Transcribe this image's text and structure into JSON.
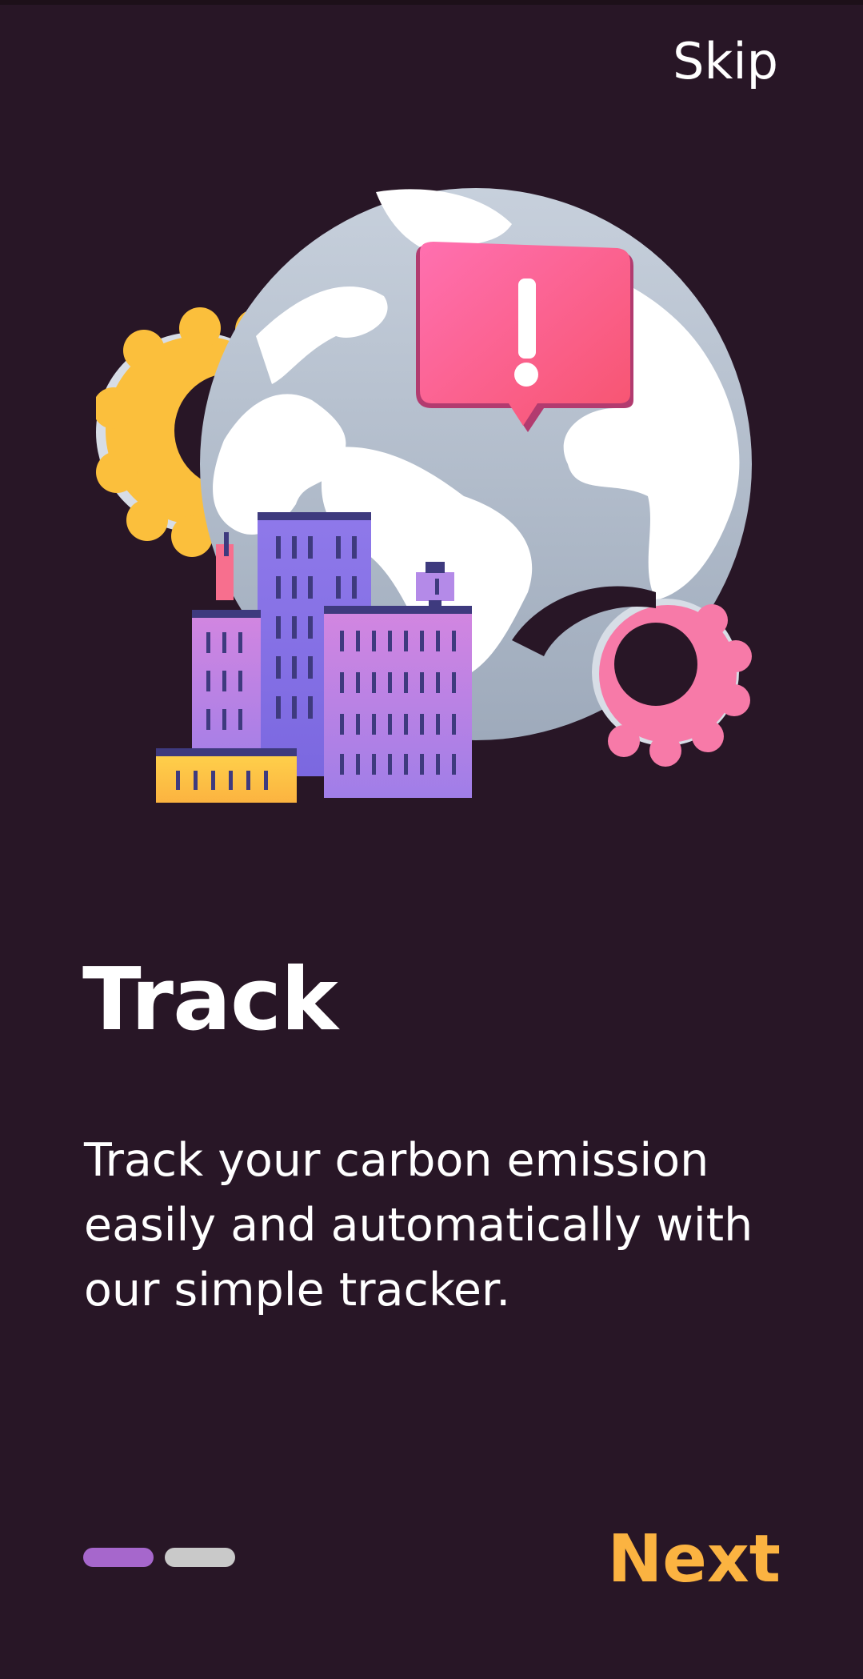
{
  "header": {
    "skip_label": "Skip"
  },
  "illustration": {
    "icons": [
      "globe-icon",
      "alert-speech-bubble-icon",
      "gear-icon",
      "city-buildings-icon"
    ],
    "colors": {
      "gear_yellow": "#fbbf3c",
      "gear_pink": "#f77aa8",
      "bubble_pink": "#f766a5",
      "building_purple": "#a07ee8",
      "globe_gray": "#b2bdcc"
    }
  },
  "content": {
    "title": "Track",
    "description": "Track your carbon emission easily and automatically with our simple tracker."
  },
  "pager": {
    "total": 2,
    "active_index": 0
  },
  "footer": {
    "next_label": "Next"
  },
  "colors": {
    "background": "#281626",
    "accent": "#fbb341",
    "active_indicator": "#a667cc",
    "inactive_indicator": "#c9c9c9"
  }
}
